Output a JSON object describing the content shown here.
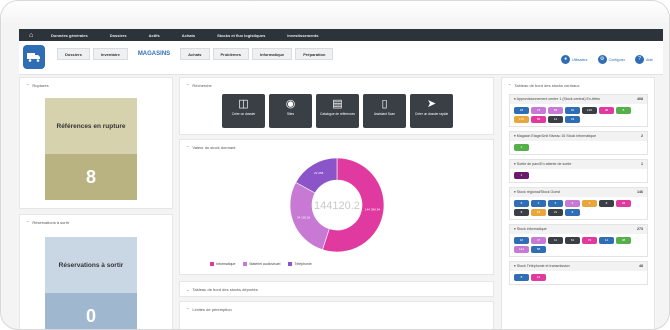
{
  "topnav": {
    "items": [
      "Données générales",
      "Dossiers",
      "Actifs",
      "Achats",
      "Stocks et flux logistiques",
      "Investissements"
    ]
  },
  "tabs": [
    {
      "label": "Dossiers",
      "active": false
    },
    {
      "label": "Inventaire",
      "active": false
    },
    {
      "label": "MAGASINS",
      "active": true
    },
    {
      "label": "Achats",
      "active": false
    },
    {
      "label": "Problèmes",
      "active": false
    },
    {
      "label": "Informatique",
      "active": false
    },
    {
      "label": "Préparation",
      "active": false
    }
  ],
  "actions": [
    {
      "label": "Utilisateur",
      "icon": "user-icon"
    },
    {
      "label": "Configurer",
      "icon": "gear-icon"
    },
    {
      "label": "Aide",
      "icon": "help-icon"
    }
  ],
  "ruptures": {
    "title": "Ruptures",
    "tile_label": "Références en rupture",
    "value": "8",
    "head_color": "#d6d2ad",
    "num_color": "#b9b382"
  },
  "reservations": {
    "title": "Réservations à sortir",
    "tile_label": "Réservations à sortir",
    "value": "0",
    "head_color": "#c9d7e4",
    "num_color": "#9fb8cf"
  },
  "recherche": {
    "title": "Recherche",
    "buttons": [
      {
        "label": "Créer un dossier",
        "icon": "inbox-icon"
      },
      {
        "label": "Sites",
        "icon": "globe-icon"
      },
      {
        "label": "Catalogue de références",
        "icon": "book-icon"
      },
      {
        "label": "Assistant Scan",
        "icon": "barcode-icon"
      },
      {
        "label": "Créer un dossier rapide",
        "icon": "send-icon"
      }
    ]
  },
  "valeur": {
    "title": "Valeur du stock dormant",
    "center": "144120.2"
  },
  "chart_data": {
    "type": "pie",
    "donut": true,
    "center_label": "144120.2",
    "series": [
      {
        "name": "Informatique",
        "value": 55,
        "label": "144 396.94",
        "color": "#e03aa0"
      },
      {
        "name": "Matériel audiovisuel",
        "value": 28,
        "label": "34 118.26",
        "color": "#c779d4"
      },
      {
        "name": "Téléphonie",
        "value": 17,
        "label": "22 458",
        "color": "#8b55c9"
      }
    ]
  },
  "tableau_deportes": {
    "title": "Tableau de bord des stocks déportés"
  },
  "limites": {
    "title": "Limites de péremption"
  },
  "right": {
    "title": "Tableau de bord des stocks centraux",
    "sections": [
      {
        "title": "Approvisionnement centre 1 (Stock central) En-têtes",
        "count": "408",
        "chips": [
          [
            "18",
            "#2f6db5"
          ],
          [
            "74",
            "#c779d4"
          ],
          [
            "66",
            "#c779d4"
          ],
          [
            "32",
            "#2f6db5"
          ],
          [
            "120",
            "#3a3f46"
          ],
          [
            "36",
            "#e03aa0"
          ],
          [
            "8",
            "#55b04a"
          ],
          [
            "176",
            "#e8a63c"
          ],
          [
            "59",
            "#e03aa0"
          ],
          [
            "12",
            "#3a3f46"
          ],
          [
            "43",
            "#2f6db5"
          ]
        ]
      },
      {
        "title": "Magasin Etage/Unit Niveau 16 Stock informatique",
        "count": "2",
        "chips": [
          [
            "2",
            "#55b04a"
          ]
        ]
      },
      {
        "title": "Sortie de parc/En attente de sortie",
        "count": "1",
        "chips": [
          [
            "1",
            "#6a1a6a"
          ]
        ]
      },
      {
        "title": "Stock régional/Stock Ouest",
        "count": "146",
        "chips": [
          [
            "8",
            "#2f6db5"
          ],
          [
            "3",
            "#2f6db5"
          ],
          [
            "5",
            "#2f6db5"
          ],
          [
            "6",
            "#c779d4"
          ],
          [
            "4",
            "#e8a63c"
          ],
          [
            "8",
            "#3a3f46"
          ],
          [
            "32",
            "#e03aa0"
          ],
          [
            "8",
            "#3a3f46"
          ],
          [
            "16",
            "#e8a63c"
          ],
          [
            "21",
            "#3a3f46"
          ],
          [
            "8",
            "#2f6db5"
          ]
        ]
      },
      {
        "title": "Stock informatique",
        "count": "273",
        "chips": [
          [
            "16",
            "#2f6db5"
          ],
          [
            "47",
            "#c779d4"
          ],
          [
            "11",
            "#3a3f46"
          ],
          [
            "61",
            "#3a3f46"
          ],
          [
            "72",
            "#e03aa0"
          ],
          [
            "14",
            "#2f6db5"
          ],
          [
            "38",
            "#55b04a"
          ],
          [
            "144",
            "#c779d4"
          ],
          [
            "58",
            "#2f6db5"
          ]
        ]
      },
      {
        "title": "Stock Téléphonie et transmission",
        "count": "48",
        "chips": [
          [
            "8",
            "#2f6db5"
          ],
          [
            "12",
            "#e03aa0"
          ]
        ]
      }
    ]
  }
}
